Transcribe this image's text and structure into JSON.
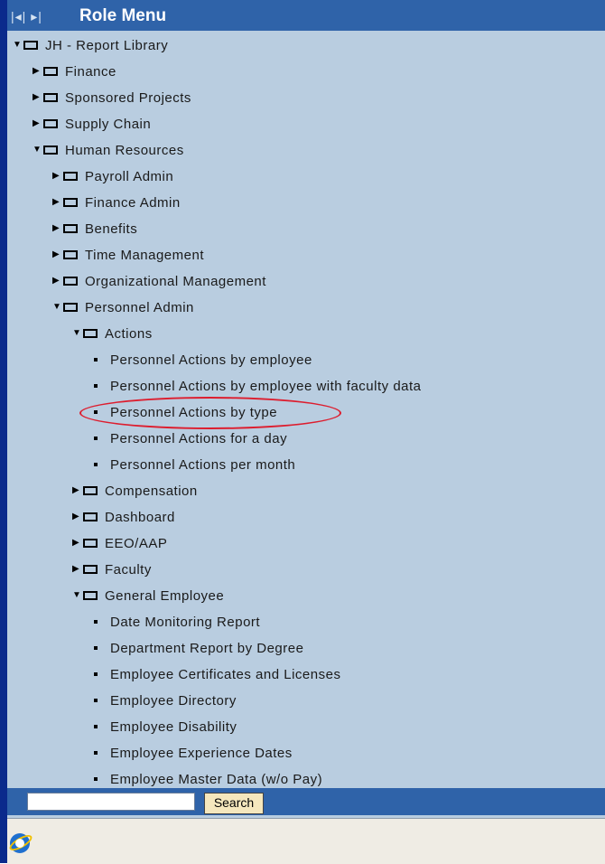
{
  "header": {
    "nav_glyph": "|◂| ▸|",
    "title": "Role Menu"
  },
  "tree": {
    "items": [
      {
        "label": "JH - Report Library",
        "type": "folder",
        "state": "expanded"
      },
      {
        "label": "Finance",
        "type": "folder",
        "state": "collapsed"
      },
      {
        "label": "Sponsored Projects",
        "type": "folder",
        "state": "collapsed"
      },
      {
        "label": "Supply Chain",
        "type": "folder",
        "state": "collapsed"
      },
      {
        "label": "Human Resources",
        "type": "folder",
        "state": "expanded"
      },
      {
        "label": "Payroll Admin",
        "type": "folder",
        "state": "collapsed"
      },
      {
        "label": "Finance Admin",
        "type": "folder",
        "state": "collapsed"
      },
      {
        "label": "Benefits",
        "type": "folder",
        "state": "collapsed"
      },
      {
        "label": "Time Management",
        "type": "folder",
        "state": "collapsed"
      },
      {
        "label": "Organizational Management",
        "type": "folder",
        "state": "collapsed"
      },
      {
        "label": "Personnel Admin",
        "type": "folder",
        "state": "expanded"
      },
      {
        "label": "Actions",
        "type": "folder",
        "state": "expanded"
      },
      {
        "label": "Personnel Actions by employee",
        "type": "report"
      },
      {
        "label": "Personnel Actions by employee with faculty data",
        "type": "report"
      },
      {
        "label": "Personnel Actions by type",
        "type": "report",
        "highlighted": true
      },
      {
        "label": "Personnel Actions for a day",
        "type": "report"
      },
      {
        "label": "Personnel Actions per month",
        "type": "report"
      },
      {
        "label": "Compensation",
        "type": "folder",
        "state": "collapsed"
      },
      {
        "label": "Dashboard",
        "type": "folder",
        "state": "collapsed"
      },
      {
        "label": "EEO/AAP",
        "type": "folder",
        "state": "collapsed"
      },
      {
        "label": "Faculty",
        "type": "folder",
        "state": "collapsed"
      },
      {
        "label": "General Employee",
        "type": "folder",
        "state": "expanded"
      },
      {
        "label": "Date Monitoring Report",
        "type": "report"
      },
      {
        "label": "Department Report by Degree",
        "type": "report"
      },
      {
        "label": "Employee Certificates and Licenses",
        "type": "report"
      },
      {
        "label": "Employee Directory",
        "type": "report"
      },
      {
        "label": "Employee Disability",
        "type": "report"
      },
      {
        "label": "Employee Experience Dates",
        "type": "report"
      },
      {
        "label": "Employee Master Data (w/o Pay)",
        "type": "report"
      }
    ]
  },
  "search": {
    "value": "",
    "button_label": "Search"
  },
  "icons": {
    "expanded": "triangle-down-icon",
    "collapsed": "triangle-right-icon",
    "folder": "folder-icon",
    "report": "report-bullet-icon",
    "browser": "internet-explorer-icon"
  },
  "colors": {
    "title_bar": "#2f63a9",
    "tree_background": "#b9cde0",
    "frame": "#0a2a8c",
    "highlight_oval": "#dd1d2e",
    "search_button": "#f5e7bd"
  }
}
